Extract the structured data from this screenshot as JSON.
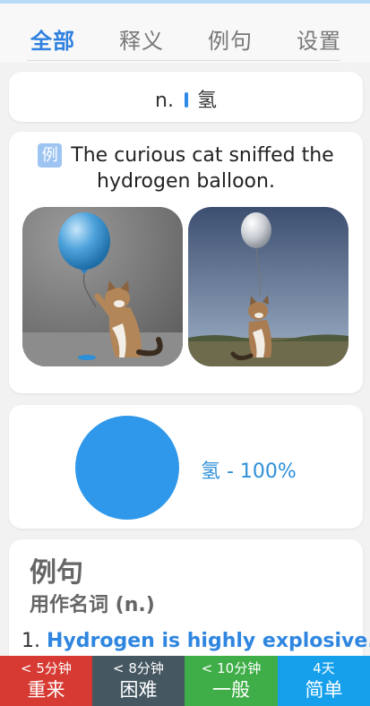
{
  "tabs": [
    {
      "label": "全部",
      "active": true
    },
    {
      "label": "释义",
      "active": false
    },
    {
      "label": "例句",
      "active": false
    },
    {
      "label": "设置",
      "active": false
    }
  ],
  "definition": {
    "pos": "n.",
    "meaning": "氢"
  },
  "example": {
    "badge": "例",
    "sentence": "The curious cat sniffed the hydrogen balloon."
  },
  "chart_data": {
    "type": "pie",
    "categories": [
      "氢"
    ],
    "values": [
      100
    ],
    "legend": "氢 - 100%",
    "colors": [
      "#2f98ea"
    ]
  },
  "sentences": {
    "title": "例句",
    "subtitle": "用作名词 (n.)",
    "items": [
      {
        "num": "1.",
        "text": "Hydrogen is highly explosive."
      }
    ]
  },
  "review_buttons": [
    {
      "time": "< 5分钟",
      "label": "重来",
      "color": "#d73a32"
    },
    {
      "time": "< 8分钟",
      "label": "困难",
      "color": "#455760"
    },
    {
      "time": "< 10分钟",
      "label": "一般",
      "color": "#3fae48"
    },
    {
      "time": "4天",
      "label": "简单",
      "color": "#16a0ec"
    }
  ]
}
